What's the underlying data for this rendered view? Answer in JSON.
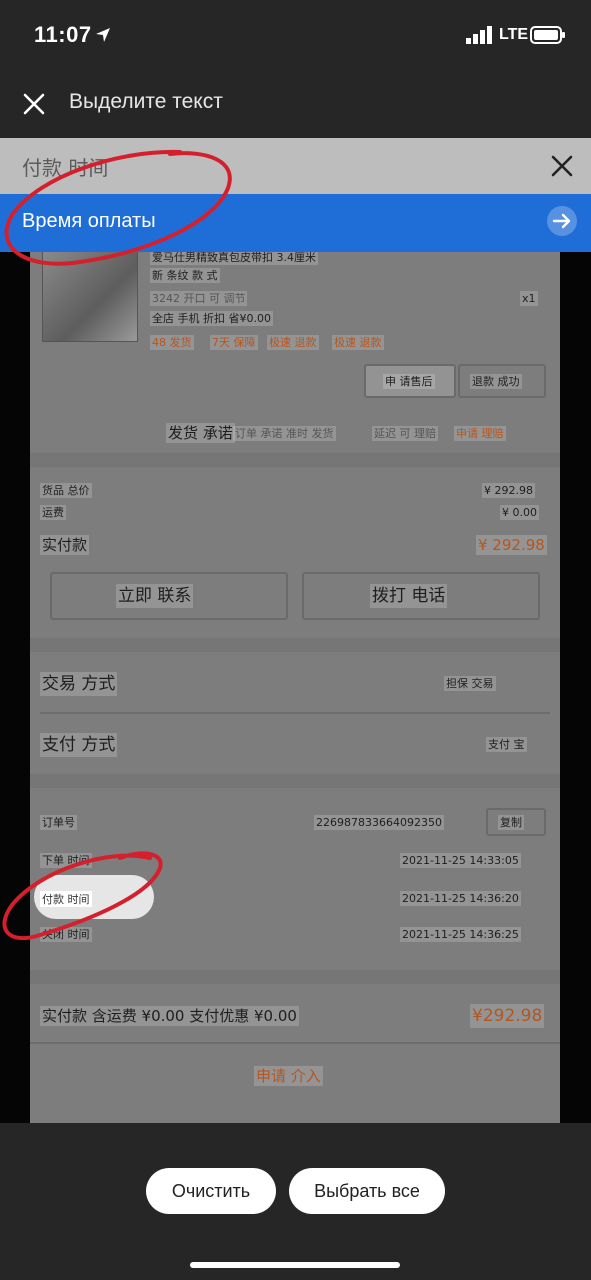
{
  "status": {
    "time": "11:07",
    "network": "LTE"
  },
  "header": {
    "title": "Выделите текст"
  },
  "suggestion": {
    "source": "付款 时间",
    "translation": "Время оплаты"
  },
  "photo": {
    "product": {
      "line1": "爱马仕男精致真包皮带扣 3.4厘米",
      "line2": "新 条纹 款 式",
      "sku": "3242 开口 可 调节",
      "qty": "x1",
      "desc": "全店 手机 折扣 省¥0.00",
      "tags": [
        "48 发货",
        "7天 保障",
        "极速 退款",
        "极速 退款"
      ]
    },
    "actions": {
      "after_sale": "申 请售后",
      "refund": "退款 成功"
    },
    "promise": {
      "label": "发货 承诺",
      "note": "订单 承诺 准时 发货",
      "delay": "延迟 可 理赔",
      "claim": "申请 理赔"
    },
    "summary": {
      "goods_total_label": "货品 总价",
      "goods_total_value": "¥ 292.98",
      "freight_label": "运费",
      "freight_value": "¥ 0.00",
      "paid_label": "实付款",
      "paid_value": "¥ 292.98"
    },
    "contact": {
      "chat": "立即 联系",
      "call": "拨打 电话"
    },
    "trade": {
      "label": "交易 方式",
      "value": "担保 交易"
    },
    "pay": {
      "label": "支付 方式",
      "value": "支付 宝"
    },
    "order": {
      "no_label": "订单号",
      "no_value": "226987833664092350",
      "copy": "复制",
      "order_time_label": "下单 时间",
      "order_time_value": "2021-11-25 14:33:05",
      "pay_time_label": "付款 时间",
      "pay_time_value": "2021-11-25 14:36:20",
      "close_time_label": "关闭 时间",
      "close_time_value": "2021-11-25 14:36:25"
    },
    "footer": {
      "paid_line": "实付款 含运费 ¥0.00 支付优惠 ¥0.00",
      "paid_amount": "¥292.98"
    },
    "intervene": "申请 介入"
  },
  "bottom": {
    "clear": "Очистить",
    "select_all": "Выбрать все"
  },
  "colors": {
    "accent_blue": "#1f6ed8",
    "annotation_red": "#d3202c"
  }
}
